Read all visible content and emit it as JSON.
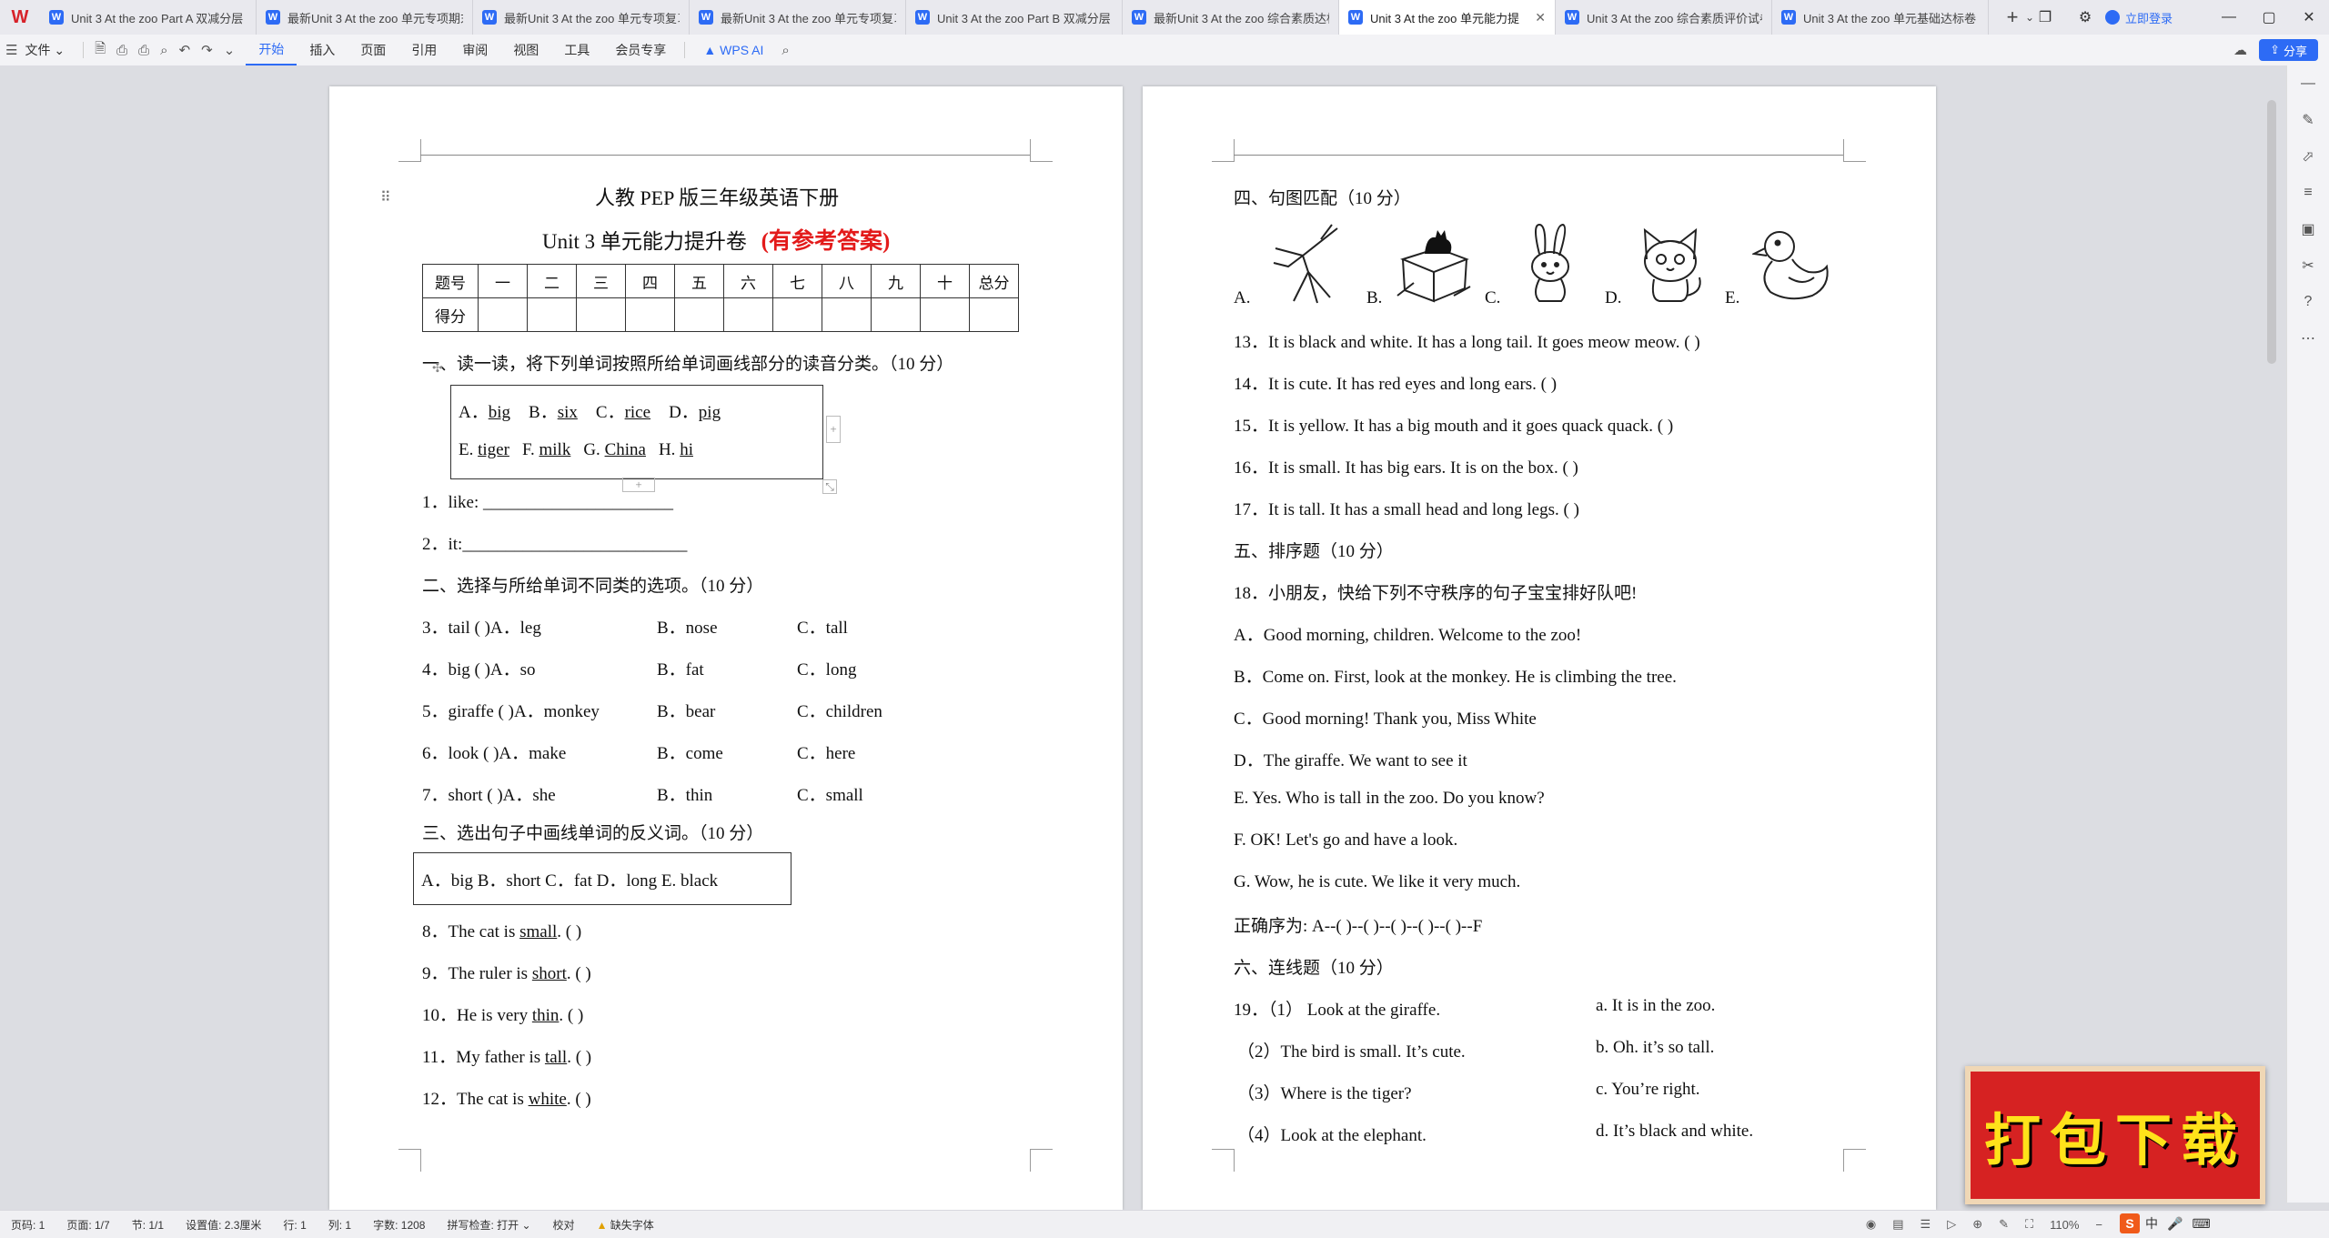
{
  "tabbar": {
    "tabs": [
      {
        "title": "Unit 3 At the zoo  Part A  双减分层"
      },
      {
        "title": "最新Unit 3 At the zoo 单元专项期末"
      },
      {
        "title": "最新Unit 3 At the zoo 单元专项复习"
      },
      {
        "title": "最新Unit 3 At the zoo 单元专项复习"
      },
      {
        "title": "Unit 3 At the zoo  Part B 双减分层"
      },
      {
        "title": "最新Unit 3 At the zoo  综合素质达标"
      },
      {
        "title": "Unit 3 At the zoo 单元能力提",
        "active": true
      },
      {
        "title": "Unit 3 At the zoo 综合素质评价试卷"
      },
      {
        "title": "Unit 3 At the zoo 单元基础达标卷"
      }
    ],
    "new_tab": "+",
    "login": "立即登录"
  },
  "ribbon": {
    "file_menu": "文件",
    "tabs": [
      "开始",
      "插入",
      "页面",
      "引用",
      "审阅",
      "视图",
      "工具",
      "会员专享"
    ],
    "active_tab": "开始",
    "wps_ai": "WPS AI",
    "share": "分享"
  },
  "page1": {
    "title1": "人教 PEP 版三年级英语下册",
    "title2": "Unit 3 单元能力提升卷",
    "title2_red": "(有参考答案)",
    "score_table": {
      "row1": [
        "题号",
        "一",
        "二",
        "三",
        "四",
        "五",
        "六",
        "七",
        "八",
        "九",
        "十",
        "总分"
      ],
      "row2": [
        "得分"
      ]
    },
    "sec1": "一、读一读，将下列单词按照所给单词画线部分的读音分类。（10 分）",
    "box1_row1": [
      {
        "pre": "A．",
        "word": "big"
      },
      {
        "pre": "B．",
        "word": "six"
      },
      {
        "pre": "C．",
        "word": "rice"
      },
      {
        "pre": "D．",
        "word": "pig"
      }
    ],
    "box1_row2": [
      {
        "pre": "E. ",
        "word": "tiger"
      },
      {
        "pre": "F. ",
        "word": "milk"
      },
      {
        "pre": "G. ",
        "word": "China"
      },
      {
        "pre": "H. ",
        "word": "hi"
      }
    ],
    "q1": "1．like: ______________________",
    "q2": "2．it:__________________________",
    "sec2": "二、选择与所给单词不同类的选项。（10 分）",
    "sec2_items": [
      {
        "q": "3．tail (    )A．leg",
        "b": "B．nose",
        "c": "C．tall"
      },
      {
        "q": "4．big (    )A．so",
        "b": "B．fat",
        "c": "C．long"
      },
      {
        "q": "5．giraffe (    )A．monkey",
        "b": "B．bear",
        "c": "C．children"
      },
      {
        "q": "6．look (    )A．make",
        "b": "B．come",
        "c": "C．here"
      },
      {
        "q": "7．short (    )A．she",
        "b": "B．thin",
        "c": "C．small"
      }
    ],
    "sec3": "三、选出句子中画线单词的反义词。（10 分）",
    "box3": "A．big   B．short   C．fat   D．long   E. black",
    "sec3_items": [
      {
        "pre": "8．The cat is ",
        "word": "small",
        "post": ". (          )"
      },
      {
        "pre": "9．The ruler is ",
        "word": "short",
        "post": ". (          )"
      },
      {
        "pre": "10．He is very ",
        "word": "thin",
        "post": ". (          )"
      },
      {
        "pre": "11．My father is ",
        "word": "tall",
        "post": ". (          )"
      },
      {
        "pre": "12．The cat is ",
        "word": "white",
        "post": ". (          )"
      }
    ]
  },
  "page2": {
    "sec4": "四、句图匹配（10 分）",
    "pic_labels": [
      "A.",
      "B.",
      "C.",
      "D.",
      "E."
    ],
    "sec4_items": [
      "13．It is black and white. It has a long tail. It goes meow meow. (          )",
      "14．It is cute. It has red eyes and long ears. (          )",
      "15．It is yellow. It has a big mouth and it goes quack quack. (          )",
      "16．It is small. It has big ears. It is on the box. (          )",
      "17．It is tall. It has a small head and long legs. (          )"
    ],
    "sec5": "五、排序题（10 分）",
    "q18": "18．小朋友，快给下列不守秩序的句子宝宝排好队吧!",
    "sec5_items": [
      "A．Good morning, children. Welcome to the zoo!",
      "B．Come on. First, look at the monkey. He is climbing the tree.",
      "C．Good morning! Thank you, Miss White",
      "D．The giraffe. We want to see it",
      "E. Yes. Who is tall in the zoo. Do you know?",
      "F. OK! Let's go and have a look.",
      "G. Wow, he is cute. We like it very much."
    ],
    "order_line": "正确序为: A--(          )--(          )--(          )--(          )--(          )--F",
    "sec6": "六、连线题（10 分）",
    "sec6_left": [
      "19．（1）  Look at the giraffe.",
      "（2）The bird is small. It’s cute.",
      "（3）Where is the tiger?",
      "（4）Look at the elephant."
    ],
    "sec6_right": [
      "a. It is in the zoo.",
      "b. Oh. it’s so tall.",
      "c. You’re right.",
      "d. It’s black and white."
    ]
  },
  "statusbar": {
    "page_num": "页码: 1",
    "pages": "页面: 1/7",
    "section": "节: 1/1",
    "setting": "设置值: 2.3厘米",
    "row": "行: 1",
    "col": "列: 1",
    "words": "字数: 1208",
    "spell": "拼写检查: 打开",
    "proof": "校对",
    "missing_font": "缺失字体",
    "zoom": "110%"
  },
  "banner": {
    "text": "打包下载"
  },
  "ime": {
    "label": "中"
  }
}
